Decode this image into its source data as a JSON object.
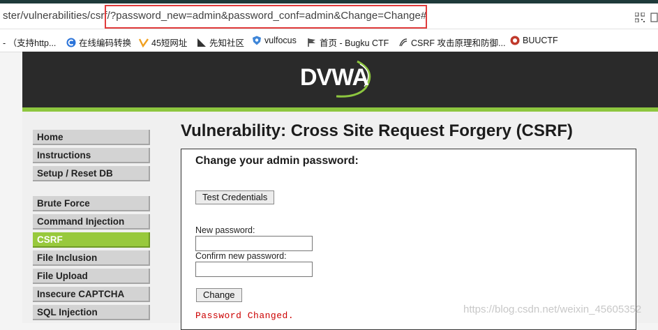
{
  "browser": {
    "url": "ster/vulnerabilities/csrf/?password_new=admin&password_conf=admin&Change=Change#",
    "bookmarks": [
      {
        "label": "- （支持http...",
        "icon": "none"
      },
      {
        "label": "在线编码转换",
        "icon": "c-logo-icon"
      },
      {
        "label": "45短网址",
        "icon": "45-icon"
      },
      {
        "label": "先知社区",
        "icon": "xianzhi-icon"
      },
      {
        "label": "vulfocus",
        "icon": "shield-icon"
      },
      {
        "label": "首页 - Bugku CTF",
        "icon": "flag-icon"
      },
      {
        "label": "CSRF 攻击原理和防御...",
        "icon": "claw-icon"
      },
      {
        "label": "BUUCTF",
        "icon": "buuctf-icon"
      }
    ]
  },
  "dvwa": {
    "logo": "DVWA",
    "menu": [
      "Home",
      "Instructions",
      "Setup / Reset DB",
      "Brute Force",
      "Command Injection",
      "CSRF",
      "File Inclusion",
      "File Upload",
      "Insecure CAPTCHA",
      "SQL Injection"
    ],
    "active_item": "CSRF",
    "title": "Vulnerability: Cross Site Request Forgery (CSRF)",
    "panel": {
      "heading": "Change your admin password:",
      "test_button": "Test Credentials",
      "new_password_label": "New password:",
      "confirm_password_label": "Confirm new password:",
      "change_button": "Change",
      "message": "Password Changed."
    }
  },
  "watermark": "https://blog.csdn.net/weixin_45605352",
  "colors": {
    "header": "#2a2a2a",
    "accent_green": "#8dc63f",
    "highlight_red": "#e03b3b",
    "message_red": "#cc0000"
  }
}
